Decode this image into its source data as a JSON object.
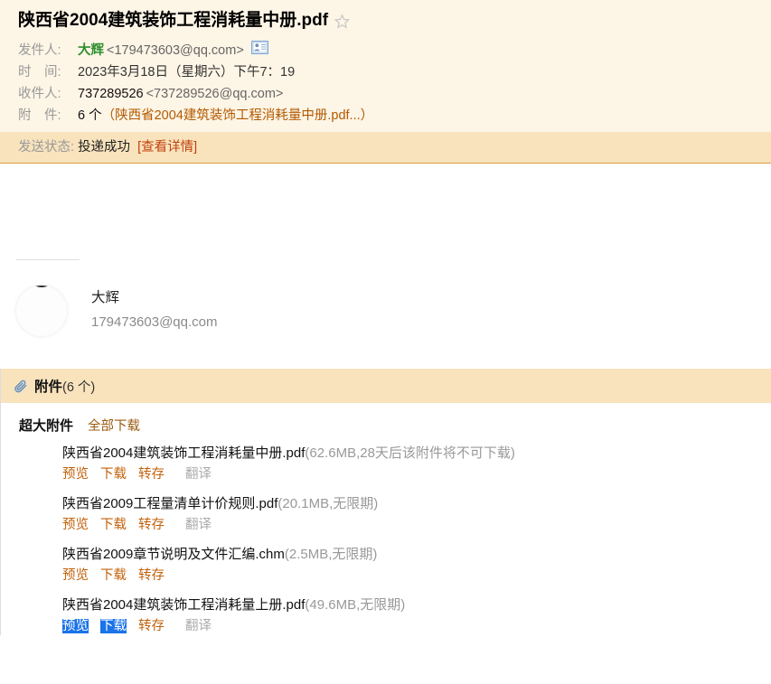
{
  "header": {
    "subject": "陕西省2004建筑装饰工程消耗量中册.pdf",
    "star_icon": "star-outline-icon",
    "from_label": "发件人:",
    "from_name": "大辉",
    "from_email": "<179473603@qq.com>",
    "vcard_icon": "contact-card-icon",
    "time_label": "时　间:",
    "time_value": "2023年3月18日（星期六）下午7：19",
    "to_label": "收件人:",
    "to_name": "737289526",
    "to_email": "<737289526@qq.com>",
    "attach_label": "附　件:",
    "attach_count": "6 个",
    "attach_summary": "（陕西省2004建筑装饰工程消耗量中册.pdf...）"
  },
  "status": {
    "label": "发送状态:",
    "value": "投递成功",
    "detail_link": "[查看详情]"
  },
  "sender_card": {
    "name": "大辉",
    "email": "179473603@qq.com",
    "avatar_icon": "user-avatar-icon"
  },
  "attachments": {
    "clip_icon": "paperclip-icon",
    "title": "附件",
    "count": "(6 个)",
    "bigfile_label": "超大附件",
    "download_all": "全部下载",
    "files": [
      {
        "name": "陕西省2004建筑装饰工程消耗量中册.pdf",
        "meta": "(62.6MB,28天后该附件将不可下载)",
        "actions": [
          "预览",
          "下载",
          "转存"
        ],
        "disabled_action": "翻译"
      },
      {
        "name": "陕西省2009工程量清单计价规则.pdf",
        "meta": "(20.1MB,无限期)",
        "actions": [
          "预览",
          "下载",
          "转存"
        ],
        "disabled_action": "翻译"
      },
      {
        "name": "陕西省2009章节说明及文件汇编.chm",
        "meta": "(2.5MB,无限期)",
        "actions": [
          "预览",
          "下载",
          "转存"
        ],
        "disabled_action": ""
      },
      {
        "name": "陕西省2004建筑装饰工程消耗量上册.pdf",
        "meta": "(49.6MB,无限期)",
        "actions": [
          "预览",
          "下载",
          "转存"
        ],
        "disabled_action": "翻译"
      }
    ]
  },
  "colors": {
    "header_bg": "#fdf5e6",
    "status_bg": "#f8e3bd",
    "status_border": "#d79b45",
    "link_orange": "#c2610a",
    "sender_green": "#2f8f2f",
    "muted_gray": "#999999",
    "selection_blue": "#1a73e8"
  }
}
